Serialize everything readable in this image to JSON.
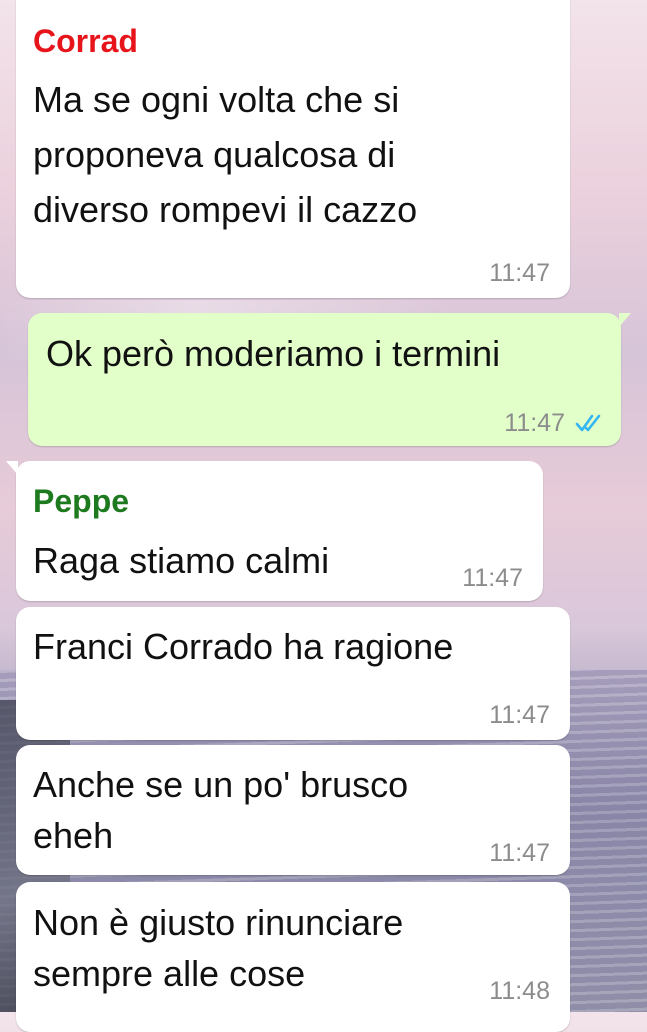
{
  "colors": {
    "incoming_bubble": "#ffffff",
    "outgoing_bubble": "#e2ffc9",
    "sender_corrad": "#e8141c",
    "sender_peppe": "#1e7a1e",
    "time": "#8c8c8c",
    "read_ticks": "#34b7f1"
  },
  "messages": [
    {
      "direction": "incoming",
      "sender": "Corrad",
      "lines": [
        "Ma se ogni volta che si",
        "proponeva qualcosa di",
        "diverso rompevi il cazzo"
      ],
      "time": "11:47"
    },
    {
      "direction": "outgoing",
      "lines": [
        "Ok però moderiamo i termini"
      ],
      "time": "11:47",
      "status_icon": "double-check-read-icon"
    },
    {
      "direction": "incoming",
      "sender": "Peppe",
      "lines": [
        "Raga stiamo calmi"
      ],
      "time": "11:47"
    },
    {
      "direction": "incoming",
      "lines": [
        "Franci Corrado ha ragione"
      ],
      "time": "11:47"
    },
    {
      "direction": "incoming",
      "lines": [
        "Anche se un po' brusco",
        "eheh"
      ],
      "time": "11:47"
    },
    {
      "direction": "incoming",
      "lines": [
        "Non è giusto rinunciare",
        "sempre alle cose"
      ],
      "time": "11:48"
    }
  ]
}
